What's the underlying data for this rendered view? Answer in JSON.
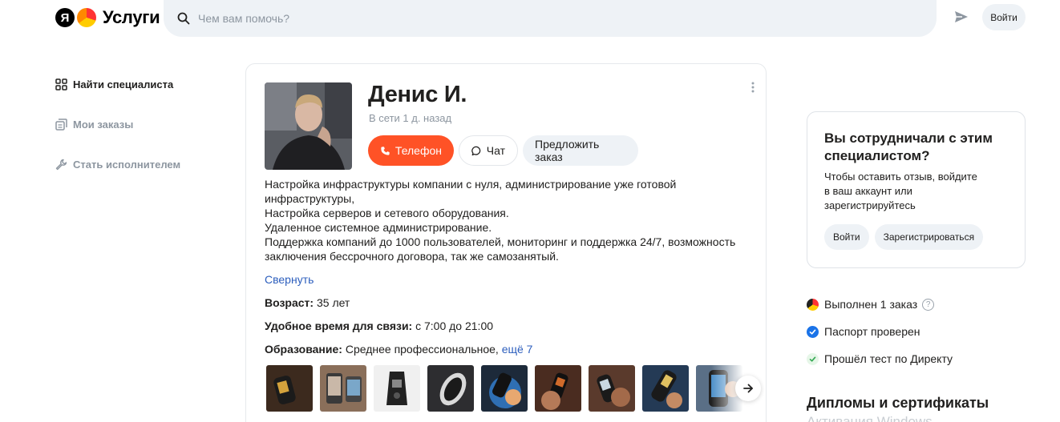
{
  "header": {
    "logo_letter": "Я",
    "logo_text": "Услуги",
    "search_placeholder": "Чем вам помочь?",
    "login_label": "Войти"
  },
  "nav": {
    "items": [
      {
        "label": "Найти специалиста",
        "icon": "grid-icon"
      },
      {
        "label": "Мои заказы",
        "icon": "orders-icon"
      },
      {
        "label": "Стать исполнителем",
        "icon": "wrench-icon"
      }
    ]
  },
  "profile": {
    "name": "Денис И.",
    "status": "В сети 1 д. назад",
    "phone_label": "Телефон",
    "chat_label": "Чат",
    "offer_label": "Предложить заказ",
    "description_lines": [
      "Настройка инфраструктуры компании с нуля, администрирование уже готовой",
      "инфраструктуры,",
      "Настройка серверов и сетевого оборудования.",
      "Удаленное системное администрирование.",
      "Поддержка компаний до 1000 пользователей, мониторинг и поддержка 24/7, возможность",
      "заключения бессрочного договора, так же самозанятый."
    ],
    "collapse_label": "Свернуть",
    "age_label": "Возраст:",
    "age_value": "35 лет",
    "contact_time_label": "Удобное время для связи:",
    "contact_time_value": "с 7:00 до 21:00",
    "education_label": "Образование:",
    "education_value": "Среднее профессиональное,",
    "education_more": "ещё 7"
  },
  "colors": {
    "accent": "#ff5226",
    "link": "#2c5ebd",
    "muted": "#8d96a0",
    "chip_bg": "#eef2f6"
  },
  "cooperate": {
    "title": "Вы сотрудничали с этим специалистом?",
    "text_lines": [
      "Чтобы оставить отзыв, войдите",
      "в ваш аккаунт или",
      "зарегистрируйтесь"
    ],
    "login_label": "Войти",
    "register_label": "Зарегистрироваться"
  },
  "badges": [
    {
      "label": "Выполнен 1 заказ",
      "icon": "yandex-services-icon"
    },
    {
      "label": "Паспорт проверен",
      "icon": "verified-check-icon"
    },
    {
      "label": "Прошёл тест по Директу",
      "icon": "test-passed-icon"
    }
  ],
  "diplomas": {
    "title": "Дипломы и сертификаты",
    "subtitle": "Активация Windows"
  }
}
